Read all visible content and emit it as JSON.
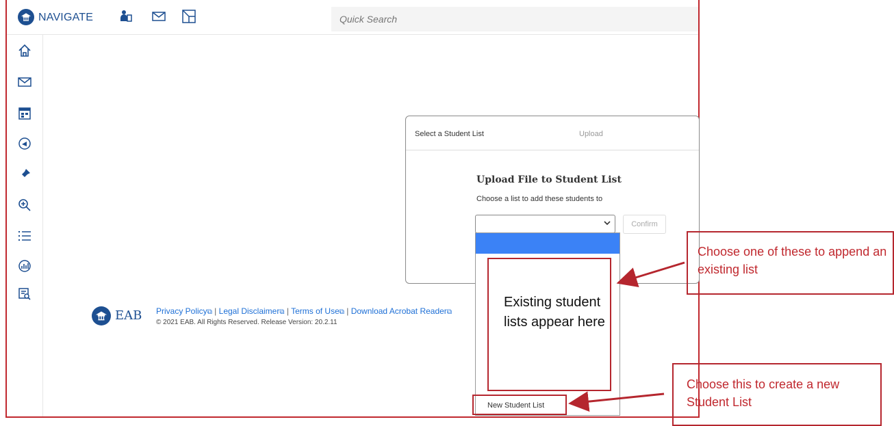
{
  "topbar": {
    "brand": "NAVIGATE",
    "search_placeholder": "Quick Search",
    "icons": [
      "students-icon",
      "mail-icon",
      "flow-icon"
    ]
  },
  "sidebar": {
    "icons": [
      "home-icon",
      "mail-icon",
      "calendar-icon",
      "campaign-icon",
      "pin-icon",
      "zoom-icon",
      "list-icon",
      "analytics-icon",
      "report-search-icon"
    ]
  },
  "panel": {
    "tab_select": "Select a Student List",
    "tab_upload": "Upload",
    "title": "Upload File to Student List",
    "subtitle": "Choose a list to add these students to",
    "confirm_label": "Confirm"
  },
  "dropdown": {
    "new_list_label": "New Student List"
  },
  "footer": {
    "logo_text": "EAB",
    "links": [
      "Privacy Policy",
      "Legal Disclaimer",
      "Terms of Use",
      "Download Acrobat Reader"
    ],
    "separator": "|",
    "copyright": "© 2021 EAB. All Rights Reserved. Release Version: 20.2.11"
  },
  "annotations": {
    "existing_lists": "Existing student lists appear here",
    "append_note": "Choose one of these to append an existing list",
    "create_note": "Choose this to create a new Student List"
  },
  "colors": {
    "brand_blue": "#1d4f91",
    "annotation_red": "#c0282e",
    "highlight_blue": "#3b82f6"
  }
}
